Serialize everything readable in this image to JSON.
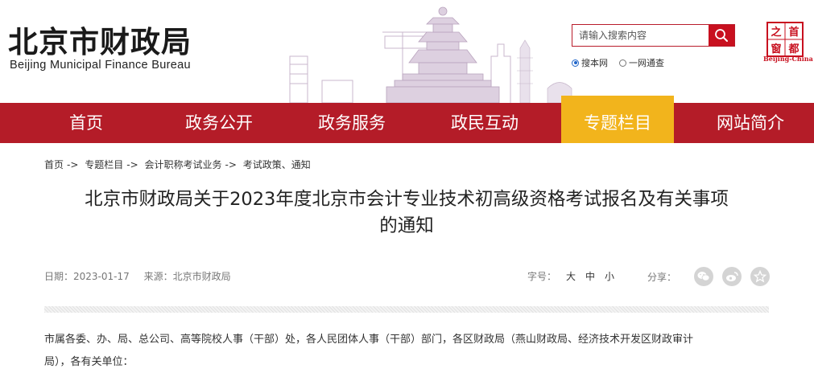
{
  "header": {
    "logo_cn": "北京市财政局",
    "logo_en": "Beijing Municipal Finance Bureau",
    "search": {
      "placeholder": "请输入搜索内容",
      "scopes": [
        {
          "label": "搜本网",
          "selected": true
        },
        {
          "label": "一网通查",
          "selected": false
        }
      ]
    },
    "seal": {
      "chars": [
        "首",
        "都",
        "之",
        "窗"
      ],
      "label": "Beijing-China"
    }
  },
  "nav": {
    "items": [
      {
        "label": "首页",
        "active": false
      },
      {
        "label": "政务公开",
        "active": false
      },
      {
        "label": "政务服务",
        "active": false
      },
      {
        "label": "政民互动",
        "active": false
      },
      {
        "label": "专题栏目",
        "active": true
      },
      {
        "label": "网站简介",
        "active": false
      }
    ]
  },
  "breadcrumb": [
    "首页",
    "->",
    "专题栏目",
    "->",
    "会计职称考试业务",
    "->",
    "考试政策、通知"
  ],
  "article": {
    "title_line1": "北京市财政局关于2023年度北京市会计专业技术初高级资格考试报名及有关事项",
    "title_line2": "的通知",
    "date": "日期：2023-01-17",
    "source": "来源：北京市财政局",
    "fontsize_label": "字号：",
    "fontsize_options": [
      "大",
      "中",
      "小"
    ],
    "share_label": "分享：",
    "body_line1": "市属各委、办、局、总公司、高等院校人事（干部）处，各人民团体人事（干部）部门，各区财政局（燕山财政局、经济技术开发区财政审计",
    "body_line2": "局），各有关单位："
  },
  "colors": {
    "nav_bg": "#b41c28",
    "nav_active": "#f2b41c",
    "search_btn": "#c8101f"
  },
  "icons": {
    "search": "search-icon",
    "share": [
      "wechat-icon",
      "weibo-icon",
      "favorite-star-icon"
    ]
  }
}
